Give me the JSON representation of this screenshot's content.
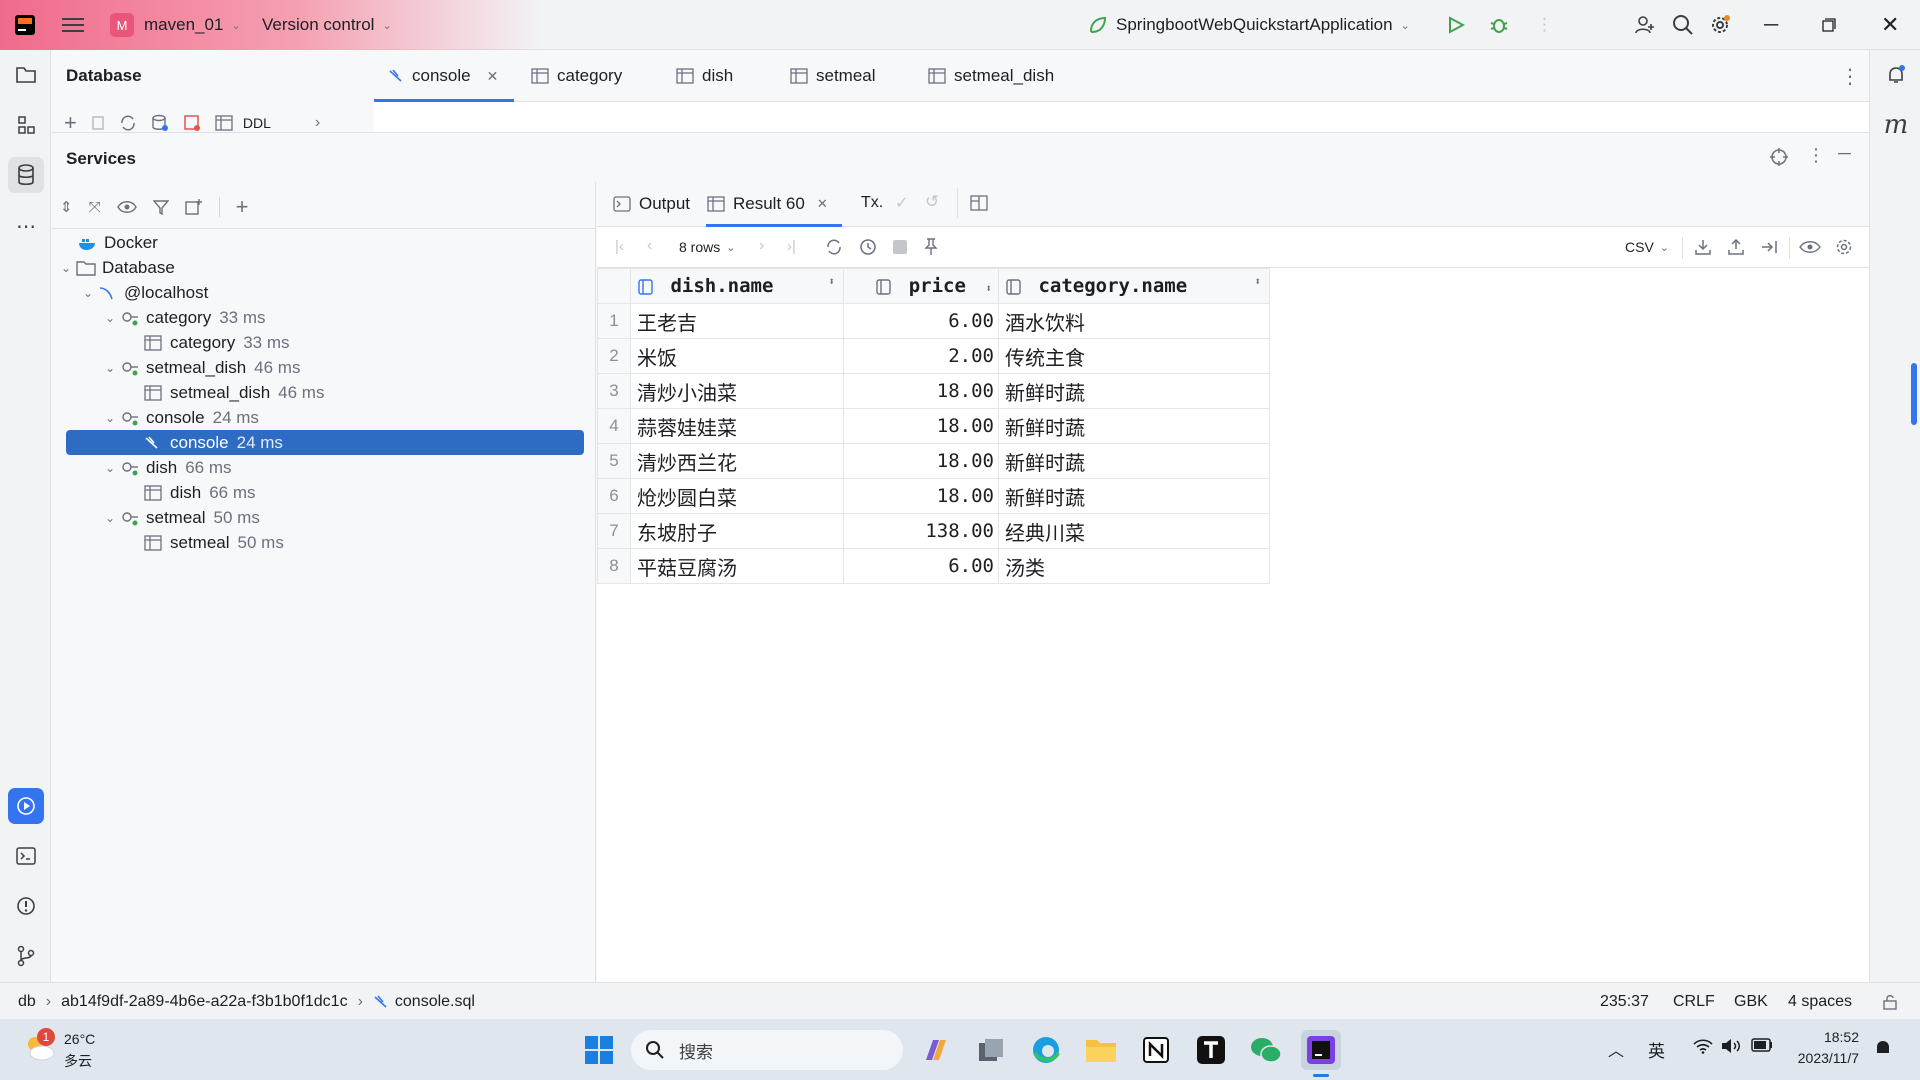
{
  "titlebar": {
    "project_badge": "M",
    "project_name": "maven_01",
    "vcs_label": "Version control",
    "run_config": "SpringbootWebQuickstartApplication"
  },
  "db_panel": {
    "title": "Database",
    "ddl_label": "DDL"
  },
  "editor_tabs": [
    {
      "label": "console",
      "icon": "sql-console-icon"
    },
    {
      "label": "category",
      "icon": "table-icon"
    },
    {
      "label": "dish",
      "icon": "table-icon"
    },
    {
      "label": "setmeal",
      "icon": "table-icon"
    },
    {
      "label": "setmeal_dish",
      "icon": "table-icon"
    }
  ],
  "services": {
    "title": "Services",
    "tree": [
      {
        "label": "Docker",
        "ms": ""
      },
      {
        "label": "Database",
        "ms": ""
      },
      {
        "label": "@localhost",
        "ms": ""
      },
      {
        "label": "category",
        "ms": "33 ms"
      },
      {
        "label": "category",
        "ms": "33 ms"
      },
      {
        "label": "setmeal_dish",
        "ms": "46 ms"
      },
      {
        "label": "setmeal_dish",
        "ms": "46 ms"
      },
      {
        "label": "console",
        "ms": "24 ms"
      },
      {
        "label": "console",
        "ms": "24 ms"
      },
      {
        "label": "dish",
        "ms": "66 ms"
      },
      {
        "label": "dish",
        "ms": "66 ms"
      },
      {
        "label": "setmeal",
        "ms": "50 ms"
      },
      {
        "label": "setmeal",
        "ms": "50 ms"
      }
    ]
  },
  "results": {
    "tabs": {
      "output": "Output",
      "result": "Result 60",
      "tx": "Tx."
    },
    "rows_label": "8 rows",
    "export_format": "CSV",
    "columns": [
      "dish.name",
      "price",
      "category.name"
    ],
    "rows": [
      {
        "n": "1",
        "name": "王老吉",
        "price": "6.00",
        "cat": "酒水饮料"
      },
      {
        "n": "2",
        "name": "米饭",
        "price": "2.00",
        "cat": "传统主食"
      },
      {
        "n": "3",
        "name": "清炒小油菜",
        "price": "18.00",
        "cat": "新鲜时蔬"
      },
      {
        "n": "4",
        "name": "蒜蓉娃娃菜",
        "price": "18.00",
        "cat": "新鲜时蔬"
      },
      {
        "n": "5",
        "name": "清炒西兰花",
        "price": "18.00",
        "cat": "新鲜时蔬"
      },
      {
        "n": "6",
        "name": "炝炒圆白菜",
        "price": "18.00",
        "cat": "新鲜时蔬"
      },
      {
        "n": "7",
        "name": "东坡肘子",
        "price": "138.00",
        "cat": "经典川菜"
      },
      {
        "n": "8",
        "name": "平菇豆腐汤",
        "price": "6.00",
        "cat": "汤类"
      }
    ]
  },
  "statusbar": {
    "crumb1": "db",
    "crumb2": "ab14f9df-2a89-4b6e-a22a-f3b1b0f1dc1c",
    "crumb3": "console.sql",
    "position": "235:37",
    "line_sep": "CRLF",
    "encoding": "GBK",
    "indent": "4 spaces"
  },
  "taskbar": {
    "weather_temp": "26°C",
    "weather_desc": "多云",
    "weather_badge": "1",
    "search_placeholder": "搜索",
    "ime": "英",
    "time": "18:52",
    "date": "2023/11/7"
  },
  "colors": {
    "accent": "#2e6cc4",
    "project": "#e9567a",
    "run": "#3fa34d"
  }
}
